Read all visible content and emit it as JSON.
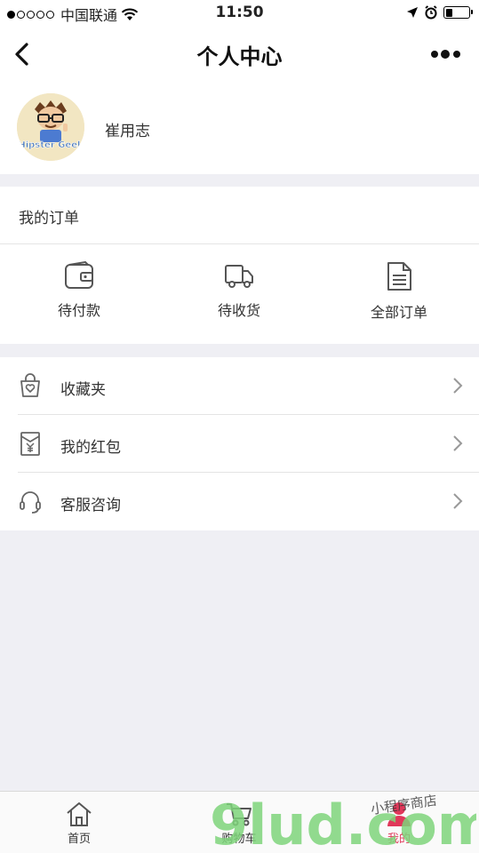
{
  "status_bar": {
    "carrier": "中国联通",
    "time": "11:50"
  },
  "nav": {
    "title": "个人中心"
  },
  "profile": {
    "username": "崔用志",
    "avatar_text": "Hipster Geek"
  },
  "orders": {
    "title": "我的订单",
    "items": [
      {
        "label": "待付款",
        "icon": "wallet-icon"
      },
      {
        "label": "待收货",
        "icon": "truck-icon"
      },
      {
        "label": "全部订单",
        "icon": "document-icon"
      }
    ]
  },
  "menu": {
    "items": [
      {
        "label": "收藏夹",
        "icon": "shopping-bag-heart-icon"
      },
      {
        "label": "我的红包",
        "icon": "red-envelope-icon"
      },
      {
        "label": "客服咨询",
        "icon": "headset-icon"
      }
    ]
  },
  "tabbar": {
    "items": [
      {
        "label": "首页",
        "icon": "home-icon"
      },
      {
        "label": "购物车",
        "icon": "cart-icon"
      },
      {
        "label": "我的",
        "icon": "user-icon",
        "active": true
      }
    ]
  },
  "watermark": {
    "logo": "9lud.com",
    "caption": "小程序商店"
  },
  "colors": {
    "accent": "#e0385a",
    "background": "#efeff4",
    "watermark_green": "#7ed37a"
  }
}
